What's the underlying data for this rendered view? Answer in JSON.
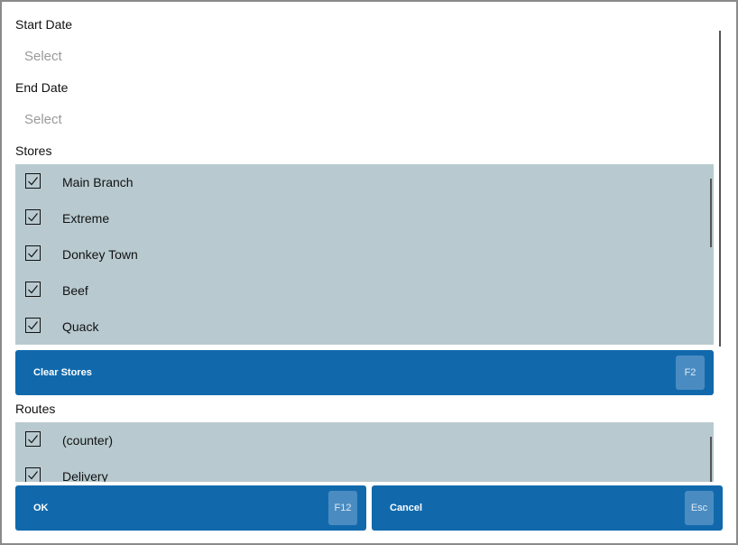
{
  "start_date": {
    "label": "Start Date",
    "placeholder": "Select"
  },
  "end_date": {
    "label": "End Date",
    "placeholder": "Select"
  },
  "stores": {
    "label": "Stores",
    "items": [
      {
        "label": "Main Branch",
        "checked": true
      },
      {
        "label": "Extreme",
        "checked": true
      },
      {
        "label": "Donkey Town",
        "checked": true
      },
      {
        "label": "Beef",
        "checked": true
      },
      {
        "label": "Quack",
        "checked": true
      }
    ],
    "clear_button": {
      "label": "Clear Stores",
      "shortcut": "F2"
    }
  },
  "routes": {
    "label": "Routes",
    "items": [
      {
        "label": "(counter)",
        "checked": true
      },
      {
        "label": "Delivery",
        "checked": true
      }
    ]
  },
  "footer": {
    "ok": {
      "label": "OK",
      "shortcut": "F12"
    },
    "cancel": {
      "label": "Cancel",
      "shortcut": "Esc"
    }
  },
  "colors": {
    "accent": "#1169ac",
    "list_background": "#b8cad0",
    "shortcut_background": "#4a8cc1"
  }
}
